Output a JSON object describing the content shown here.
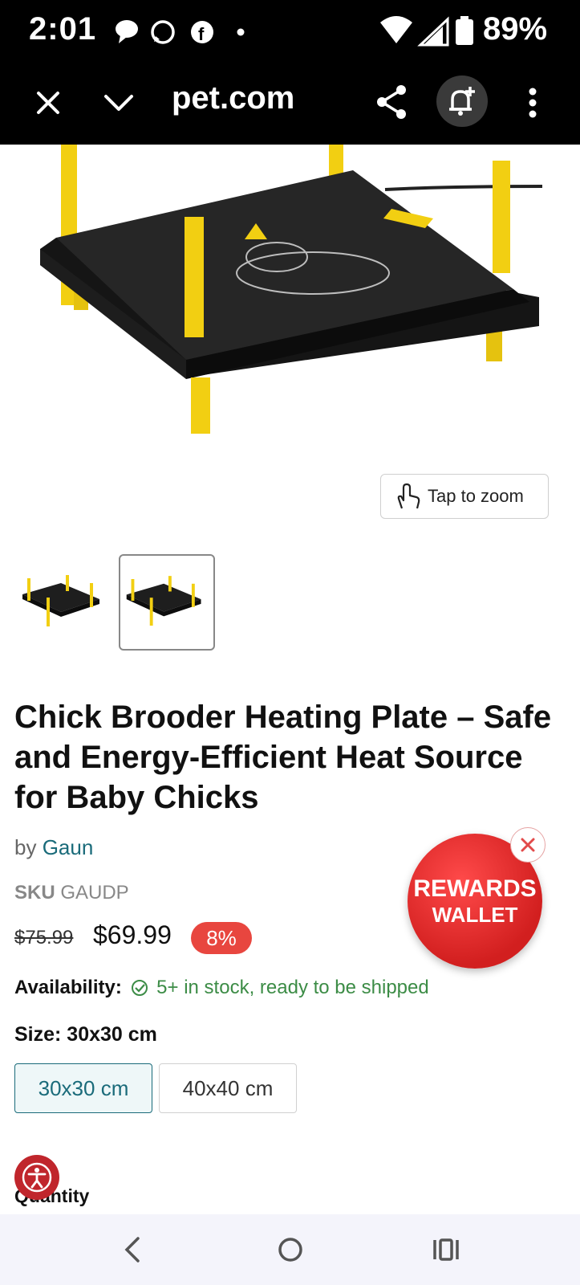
{
  "status_bar": {
    "time": "2:01",
    "battery": "89%"
  },
  "browser": {
    "url": "pet.com"
  },
  "gallery": {
    "zoom_label": "Tap to zoom"
  },
  "product": {
    "title": "Chick Brooder Heating Plate – Safe and Energy-Efficient Heat Source for Baby Chicks",
    "by_prefix": "by",
    "brand": "Gaun",
    "sku_key": "SKU",
    "sku_value": "GAUDP",
    "price_old": "$75.99",
    "price_new": "$69.99",
    "discount": "8%",
    "availability_key": "Availability:",
    "availability_value": "5+ in stock, ready to be shipped",
    "size_label": "Size: 30x30 cm",
    "size_options": [
      "30x30 cm",
      "40x40 cm"
    ],
    "selected_size": "30x30 cm",
    "quantity_label": "Quantity"
  },
  "rewards": {
    "line1": "REWARDS",
    "line2": "WALLET"
  },
  "colors": {
    "accent": "#1a6b7a",
    "discount": "#e8463f",
    "in_stock": "#3c8c46",
    "rewards": "#d21f1f"
  }
}
